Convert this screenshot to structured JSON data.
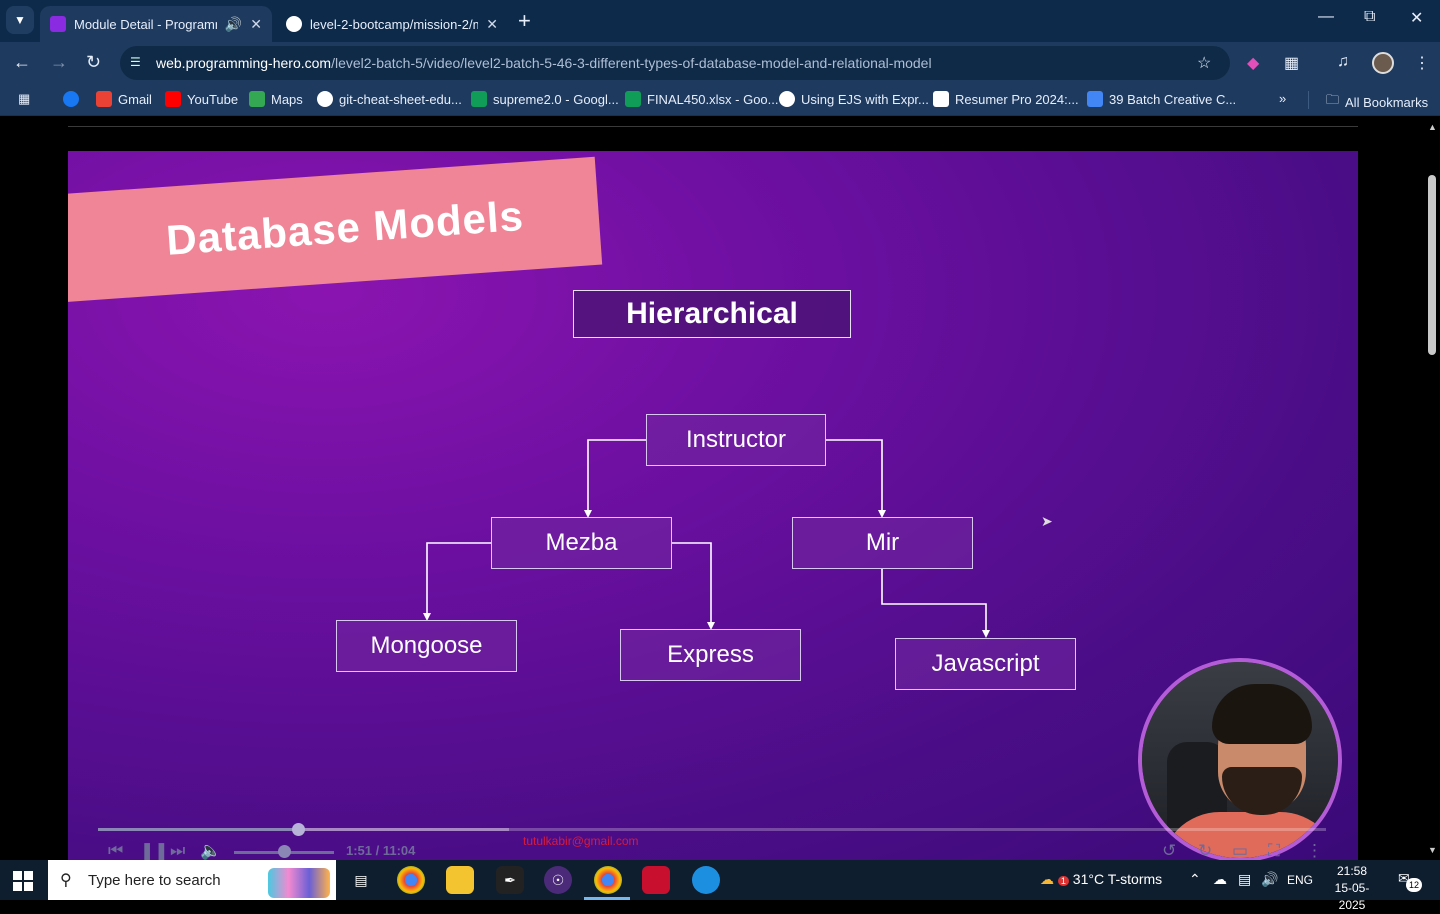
{
  "browser": {
    "tabs": [
      {
        "title": "Module Detail - Programmi",
        "favicon_color": "#8a2be2",
        "audio": "🔊",
        "close": "✕"
      },
      {
        "title": "level-2-bootcamp/mission-2/m",
        "favicon_color": "#ffffff",
        "close": "✕"
      }
    ],
    "new_tab": "+",
    "url_host": "web.programming-hero.com",
    "url_path": "/level2-batch-5/video/level2-batch-5-46-3-different-types-of-database-model-and-relational-model",
    "bookmarks": [
      {
        "label": "",
        "icon_color": "#1877f2"
      },
      {
        "label": "Gmail",
        "icon_color": "#ea4335"
      },
      {
        "label": "YouTube",
        "icon_color": "#ff0000"
      },
      {
        "label": "Maps",
        "icon_color": "#34a853"
      },
      {
        "label": "git-cheat-sheet-edu...",
        "icon_color": "#ffffff"
      },
      {
        "label": "supreme2.0 - Googl...",
        "icon_color": "#0f9d58"
      },
      {
        "label": "FINAL450.xlsx - Goo...",
        "icon_color": "#0f9d58"
      },
      {
        "label": "Using EJS with Expr...",
        "icon_color": "#ffffff"
      },
      {
        "label": "Resumer Pro 2024:...",
        "icon_color": "#ffffff"
      },
      {
        "label": "39 Batch Creative C...",
        "icon_color": "#4285f4"
      }
    ],
    "more_bookmarks": "»",
    "all_bookmarks": "All Bookmarks"
  },
  "slide": {
    "banner": "Database Models",
    "heading": "Hierarchical",
    "nodes": {
      "root": "Instructor",
      "left": "Mezba",
      "right": "Mir",
      "left_left": "Mongoose",
      "left_right": "Express",
      "right_child": "Javascript"
    }
  },
  "player": {
    "progress": 0.163,
    "buffered": 0.335,
    "volume": 0.5,
    "timecode": "1:51 / 11:04",
    "watermark": "tutulkabir@gmail.com"
  },
  "taskbar": {
    "search_placeholder": "Type here to search",
    "weather": "31°C  T-storms",
    "weather_badge": "1",
    "language": "ENG",
    "time": "21:58",
    "date": "15-05-2025",
    "notifications": "12"
  }
}
